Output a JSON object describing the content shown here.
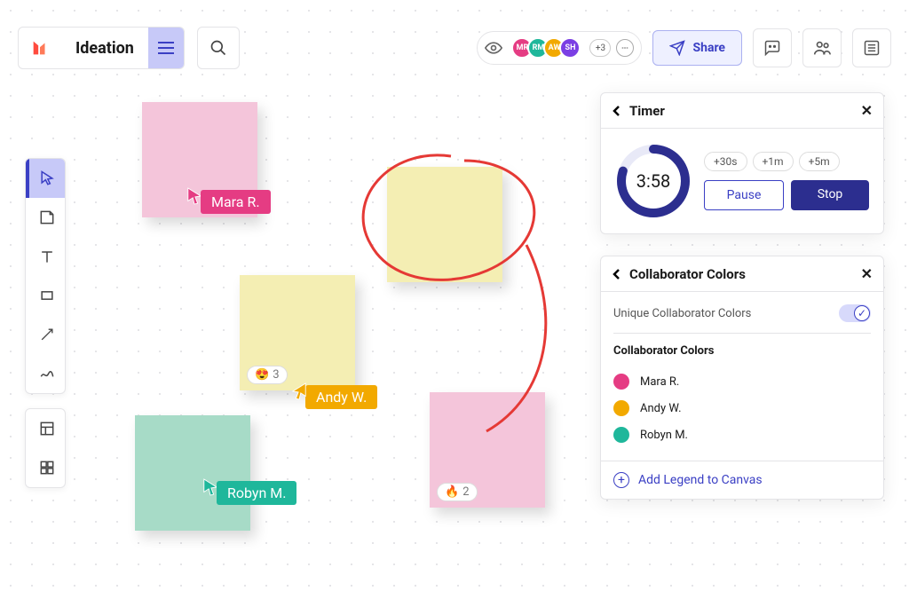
{
  "doc": {
    "title": "Ideation"
  },
  "header": {
    "share_label": "Share",
    "overflow_count": "+3",
    "avatars": [
      {
        "initials": "MR",
        "color": "#e53c83"
      },
      {
        "initials": "RM",
        "color": "#1fb79b"
      },
      {
        "initials": "AW",
        "color": "#f2a900"
      },
      {
        "initials": "SH",
        "color": "#7b3fe4"
      }
    ]
  },
  "timer": {
    "title": "Timer",
    "value": "3:58",
    "add_options": [
      "+30s",
      "+1m",
      "+5m"
    ],
    "pause_label": "Pause",
    "stop_label": "Stop"
  },
  "colors_panel": {
    "title": "Collaborator Colors",
    "toggle_label": "Unique Collaborator Colors",
    "section_label": "Collaborator Colors",
    "legend": [
      {
        "name": "Mara R.",
        "color": "#e53c83"
      },
      {
        "name": "Andy W.",
        "color": "#f2a900"
      },
      {
        "name": "Robyn M.",
        "color": "#1fb79b"
      }
    ],
    "footer_label": "Add Legend to Canvas"
  },
  "cursors": {
    "mara": {
      "label": "Mara R.",
      "color": "#e53c83"
    },
    "andy": {
      "label": "Andy W.",
      "color": "#f2a900"
    },
    "robyn": {
      "label": "Robyn M.",
      "color": "#1fb79b"
    }
  },
  "reactions": {
    "heart": {
      "emoji": "😍",
      "count": "3"
    },
    "fire": {
      "emoji": "🔥",
      "count": "2"
    }
  }
}
